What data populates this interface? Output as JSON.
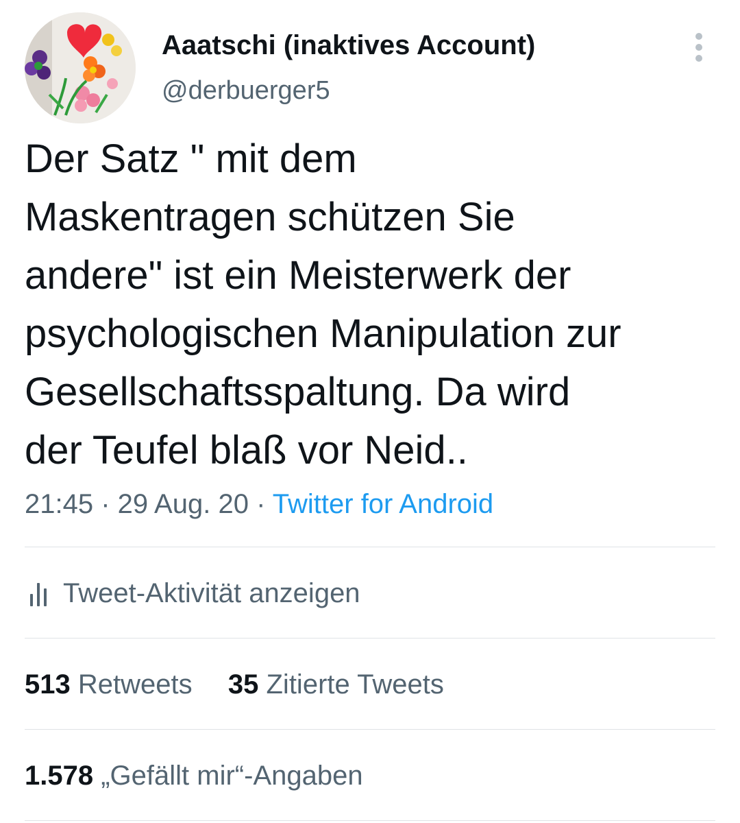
{
  "author": {
    "display_name": "Aaatschi (inaktives Account)",
    "handle": "@derbuerger5",
    "avatar_icon": "flower-drawing-avatar"
  },
  "more_icon": "more-vertical-icon",
  "tweet": {
    "text": "Der Satz \" mit dem\nMaskentragen schützen Sie\nandere\" ist ein Meisterwerk der\npsychologischen Manipulation zur\nGesellschaftsspaltung. Da wird\nder Teufel blaß vor Neid..",
    "time": "21:45",
    "separator": " · ",
    "date": "29 Aug. 20",
    "source": "Twitter for Android"
  },
  "activity": {
    "icon": "bar-chart-icon",
    "label": "Tweet-Aktivität anzeigen"
  },
  "stats": {
    "retweets_count": "513",
    "retweets_label": "Retweets",
    "quotes_count": "35",
    "quotes_label": "Zitierte Tweets",
    "likes_count": "1.578",
    "likes_label": "„Gefällt mir“-Angaben"
  },
  "colors": {
    "text": "#0f1419",
    "secondary": "#536471",
    "link": "#1d9bf0",
    "divider": "#dfe3e6"
  }
}
